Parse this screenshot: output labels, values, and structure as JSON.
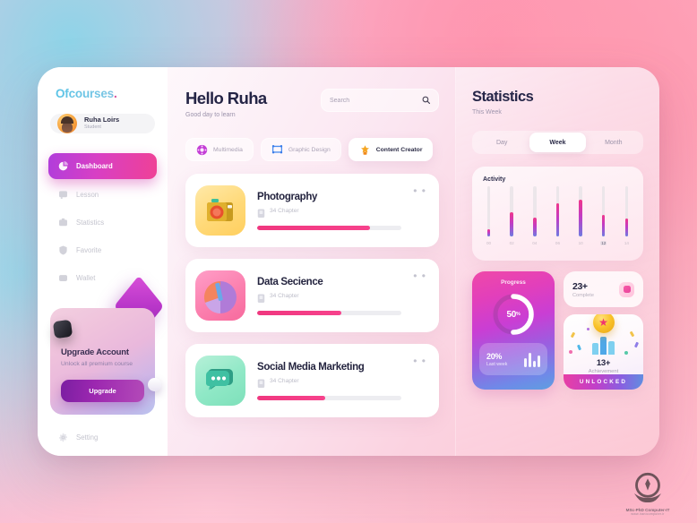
{
  "brand": {
    "name": "Ofcourses",
    "dot": "."
  },
  "sidebar": {
    "profile": {
      "name": "Ruha Loirs",
      "role": "Student",
      "avatar_icon": "user-avatar"
    },
    "items": [
      {
        "label": "Dashboard",
        "icon": "pie-chart-icon",
        "active": true
      },
      {
        "label": "Lesson",
        "icon": "book-icon",
        "active": false
      },
      {
        "label": "Statistics",
        "icon": "briefcase-icon",
        "active": false
      },
      {
        "label": "Favorite",
        "icon": "shield-icon",
        "active": false
      },
      {
        "label": "Wallet",
        "icon": "wallet-icon",
        "active": false
      }
    ],
    "setting": {
      "label": "Setting",
      "icon": "gear-icon"
    },
    "upgrade": {
      "title": "Upgrade Account",
      "subtitle": "Unlock all premium course",
      "button": "Upgrade"
    }
  },
  "main": {
    "greeting": "Hello Ruha",
    "greeting_sub": "Good day to learn",
    "search": {
      "placeholder": "Search",
      "value": "",
      "icon": "search-icon"
    },
    "chips": [
      {
        "label": "Multimedia",
        "icon": "multimedia-icon",
        "active": false
      },
      {
        "label": "Graphic Design",
        "icon": "graphic-design-icon",
        "active": false
      },
      {
        "label": "Content Creator",
        "icon": "content-creator-icon",
        "active": true
      }
    ],
    "courses": [
      {
        "title": "Photography",
        "chapters": "34 Chapter",
        "progress": 78,
        "icon": "camera-icon",
        "menu": "• •"
      },
      {
        "title": "Data Secience",
        "chapters": "34 Chapter",
        "progress": 58,
        "icon": "chart-icon",
        "menu": "• •"
      },
      {
        "title": "Social Media Marketing",
        "chapters": "34 Chapter",
        "progress": 47,
        "icon": "chat-icon",
        "menu": "• •"
      }
    ]
  },
  "stats": {
    "title": "Statistics",
    "subtitle": "This Week",
    "segments": [
      {
        "label": "Day",
        "active": false
      },
      {
        "label": "Week",
        "active": true
      },
      {
        "label": "Month",
        "active": false
      }
    ],
    "activity_title": "Activity",
    "progress": {
      "title": "Progress",
      "percent": "50",
      "percent_suffix": "%",
      "last_week_value": "20%",
      "last_week_label": "Last week"
    },
    "complete": {
      "value": "23+",
      "label": "Complete",
      "icon": "badge-icon"
    },
    "achievement": {
      "value": "13+",
      "label": "Achievement",
      "banner": "UNLOCKED",
      "icon": "medal-icon"
    }
  },
  "chart_data": {
    "type": "bar",
    "title": "Activity",
    "categories": [
      "00",
      "02",
      "04",
      "06",
      "10",
      "12",
      "14"
    ],
    "values": [
      14,
      48,
      38,
      66,
      74,
      42,
      36
    ],
    "xlabel": "",
    "ylabel": "",
    "ylim": [
      0,
      100
    ],
    "grid": false,
    "legend": false,
    "highlighted_category": "12",
    "series": [
      {
        "name": "Activity",
        "values": [
          14,
          48,
          38,
          66,
          74,
          42,
          36
        ]
      }
    ],
    "annotations": [
      "Progress 50%",
      "Last week 20%",
      "23+ Complete",
      "13+ Achievement"
    ]
  },
  "watermark": {
    "line1": "MSc-PhD Computer-IT",
    "line2": "www.iranicomputer.ir",
    "icon": "pen-book-logo"
  }
}
